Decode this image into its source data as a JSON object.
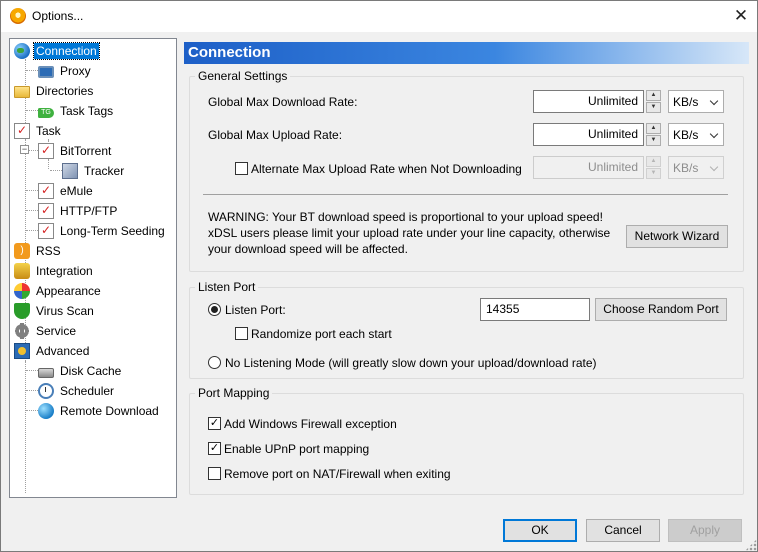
{
  "window": {
    "title": "Options..."
  },
  "tree": [
    {
      "label": "Connection",
      "icon": "globe-icon"
    },
    {
      "label": "Proxy",
      "icon": "monitor-icon"
    },
    {
      "label": "Directories",
      "icon": "folder-icon"
    },
    {
      "label": "Task Tags",
      "icon": "tag-icon"
    },
    {
      "label": "Task",
      "icon": "task-icon"
    },
    {
      "label": "BitTorrent",
      "icon": "task-icon"
    },
    {
      "label": "Tracker",
      "icon": "cube-icon"
    },
    {
      "label": "eMule",
      "icon": "task-icon"
    },
    {
      "label": "HTTP/FTP",
      "icon": "task-icon"
    },
    {
      "label": "Long-Term Seeding",
      "icon": "task-icon"
    },
    {
      "label": "RSS",
      "icon": "rss-icon"
    },
    {
      "label": "Integration",
      "icon": "plug-icon"
    },
    {
      "label": "Appearance",
      "icon": "palette-icon"
    },
    {
      "label": "Virus Scan",
      "icon": "shield-icon"
    },
    {
      "label": "Service",
      "icon": "gear-icon"
    },
    {
      "label": "Advanced",
      "icon": "advanced-icon"
    },
    {
      "label": "Disk Cache",
      "icon": "disk-icon"
    },
    {
      "label": "Scheduler",
      "icon": "clock-icon"
    },
    {
      "label": "Remote Download",
      "icon": "remote-globe-icon"
    }
  ],
  "panel": {
    "title": "Connection"
  },
  "general": {
    "legend": "General Settings",
    "download_label": "Global Max Download Rate:",
    "download_value": "Unlimited",
    "download_unit": "KB/s",
    "upload_label": "Global Max Upload Rate:",
    "upload_value": "Unlimited",
    "upload_unit": "KB/s",
    "alt_label": "Alternate Max Upload Rate when Not Downloading",
    "alt_checked": false,
    "alt_value": "Unlimited",
    "alt_unit": "KB/s",
    "warning_line1": "WARNING: Your BT download speed is proportional to your upload speed!",
    "warning_line2": "xDSL users please limit your upload rate under your line capacity, otherwise",
    "warning_line3": "your download speed will be affected.",
    "wizard_button": "Network Wizard"
  },
  "listen": {
    "legend": "Listen Port",
    "port_label": "Listen Port:",
    "port_value": "14355",
    "random_button": "Choose Random Port",
    "randomize_label": "Randomize port each start",
    "randomize_checked": false,
    "no_listen_label": "No Listening Mode (will greatly slow down your upload/download rate)"
  },
  "mapping": {
    "legend": "Port Mapping",
    "firewall_label": "Add Windows Firewall exception",
    "firewall_checked": true,
    "upnp_label": "Enable UPnP port mapping",
    "upnp_checked": true,
    "remove_label": "Remove port on NAT/Firewall when exiting",
    "remove_checked": false
  },
  "buttons": {
    "ok": "OK",
    "cancel": "Cancel",
    "apply": "Apply"
  },
  "colors": {
    "header_start": "#1d5fc7",
    "selection": "#0078d7"
  }
}
